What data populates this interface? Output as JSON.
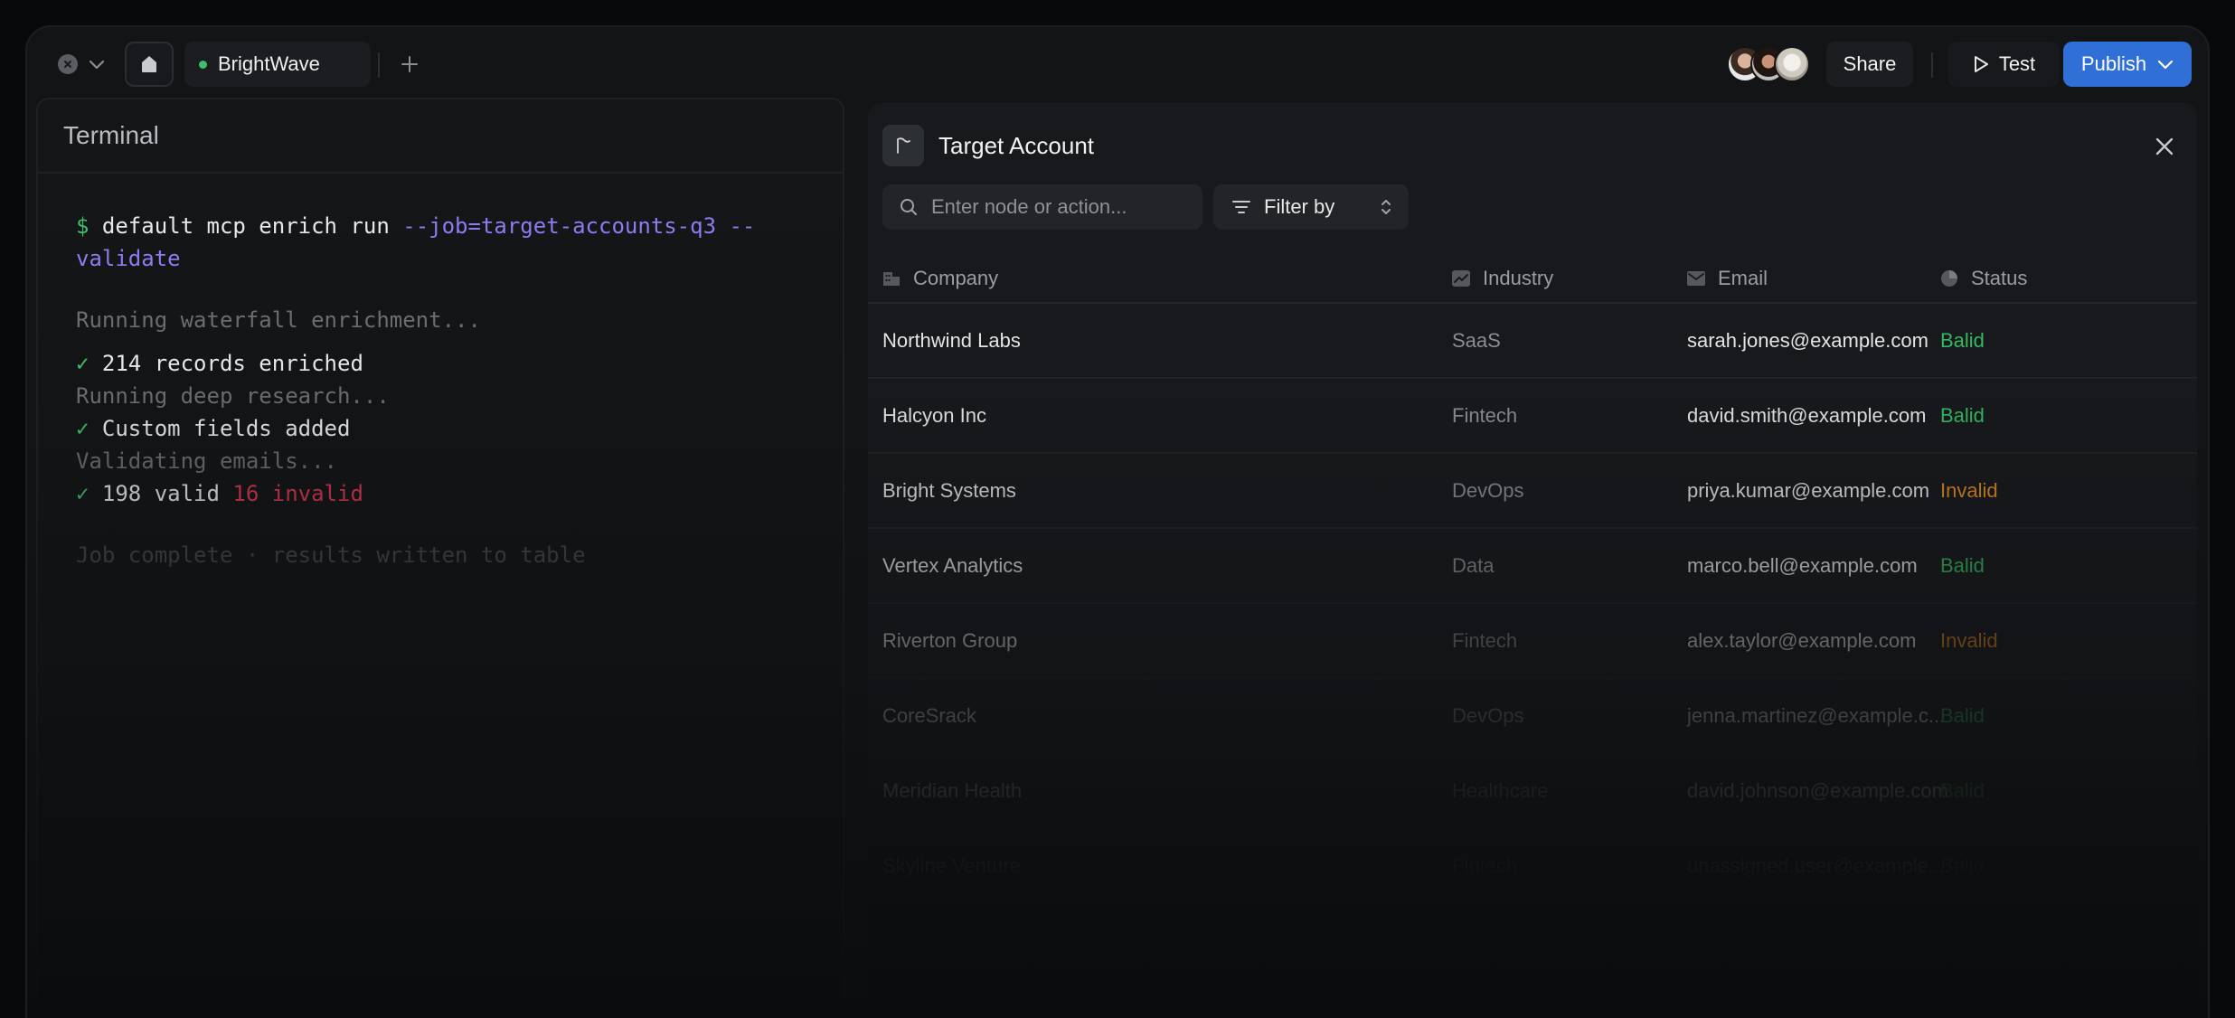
{
  "topbar": {
    "tab_label": "BrightWave",
    "share_label": "Share",
    "test_label": "Test",
    "publish_label": "Publish",
    "status_color": "#3fbf6a",
    "accent_color": "#2f6fd6"
  },
  "terminal": {
    "title": "Terminal",
    "prompt": "$",
    "command": "default mcp enrich run",
    "command_flags": "--job=target-accounts-q3 --validate",
    "line_running_waterfall": "Running waterfall enrichment...",
    "line_records": "214 records enriched",
    "line_running_research": "Running deep research...",
    "line_custom_fields": "Custom fields added",
    "line_validating": "Validating emails...",
    "line_valid": "198 valid",
    "line_invalid": "16 invalid",
    "line_complete": "Job complete · results written to table"
  },
  "panel": {
    "title": "Target Account",
    "search_placeholder": "Enter node or action...",
    "filter_label": "Filter by",
    "columns": {
      "company": "Company",
      "industry": "Industry",
      "email": "Email",
      "status": "Status"
    },
    "rows": [
      {
        "company": "Northwind Labs",
        "industry": "SaaS",
        "email": "sarah.jones@example.com",
        "status": "Balid"
      },
      {
        "company": "Halcyon Inc",
        "industry": "Fintech",
        "email": "david.smith@example.com",
        "status": "Balid"
      },
      {
        "company": "Bright Systems",
        "industry": "DevOps",
        "email": "priya.kumar@example.com",
        "status": "Invalid"
      },
      {
        "company": "Vertex Analytics",
        "industry": "Data",
        "email": "marco.bell@example.com",
        "status": "Balid"
      },
      {
        "company": "Riverton Group",
        "industry": "Fintech",
        "email": "alex.taylor@example.com",
        "status": "Invalid"
      },
      {
        "company": "CoreSrack",
        "industry": "DevOps",
        "email": "jenna.martinez@example.c...",
        "status": "Balid"
      },
      {
        "company": "Meridian Health",
        "industry": "Healthcare",
        "email": "david.johnson@example.com",
        "status": "Balid"
      },
      {
        "company": "Skyline Venture",
        "industry": "Fintech",
        "email": "unassigned.user@example....",
        "status": "Balid"
      }
    ]
  }
}
